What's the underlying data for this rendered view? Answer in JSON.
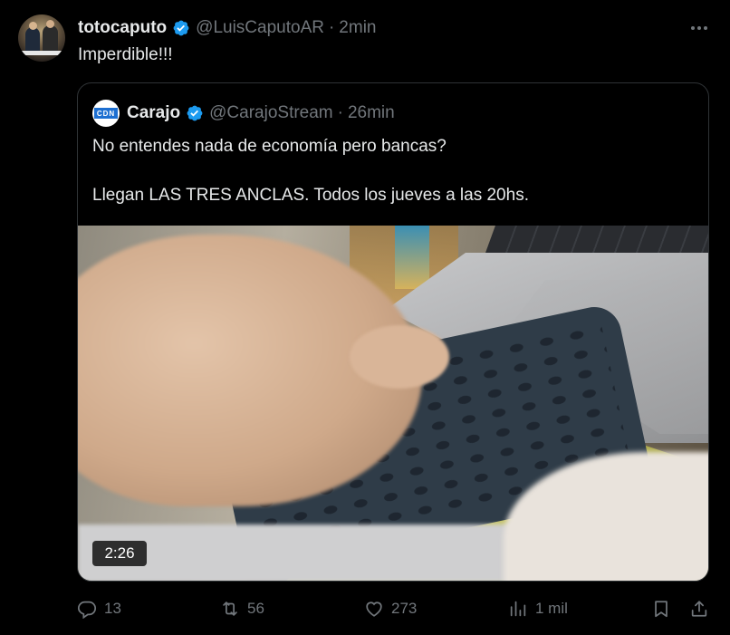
{
  "author": {
    "display_name": "totocaputo",
    "handle": "@LuisCaputoAR",
    "time": "2min",
    "separator": "·"
  },
  "tweet": {
    "text": "Imperdible!!!"
  },
  "quoted": {
    "display_name": "Carajo",
    "handle": "@CarajoStream",
    "time": "26min",
    "separator": "·",
    "logo_text": "CDN",
    "paragraphs": [
      "No entendes nada de economía pero bancas?",
      "Llegan LAS TRES ANCLAS. Todos los jueves a las 20hs."
    ],
    "video_duration": "2:26"
  },
  "actions": {
    "replies": "13",
    "reposts": "56",
    "likes": "273",
    "views": "1 mil"
  },
  "colors": {
    "background": "#000000",
    "text": "#e7e9ea",
    "muted": "#71767b",
    "verified": "#1d9bf0",
    "border": "#2f3336"
  },
  "icons": [
    "verified-badge-icon",
    "more-icon",
    "reply-icon",
    "retweet-icon",
    "like-icon",
    "views-icon",
    "bookmark-icon",
    "share-icon"
  ]
}
